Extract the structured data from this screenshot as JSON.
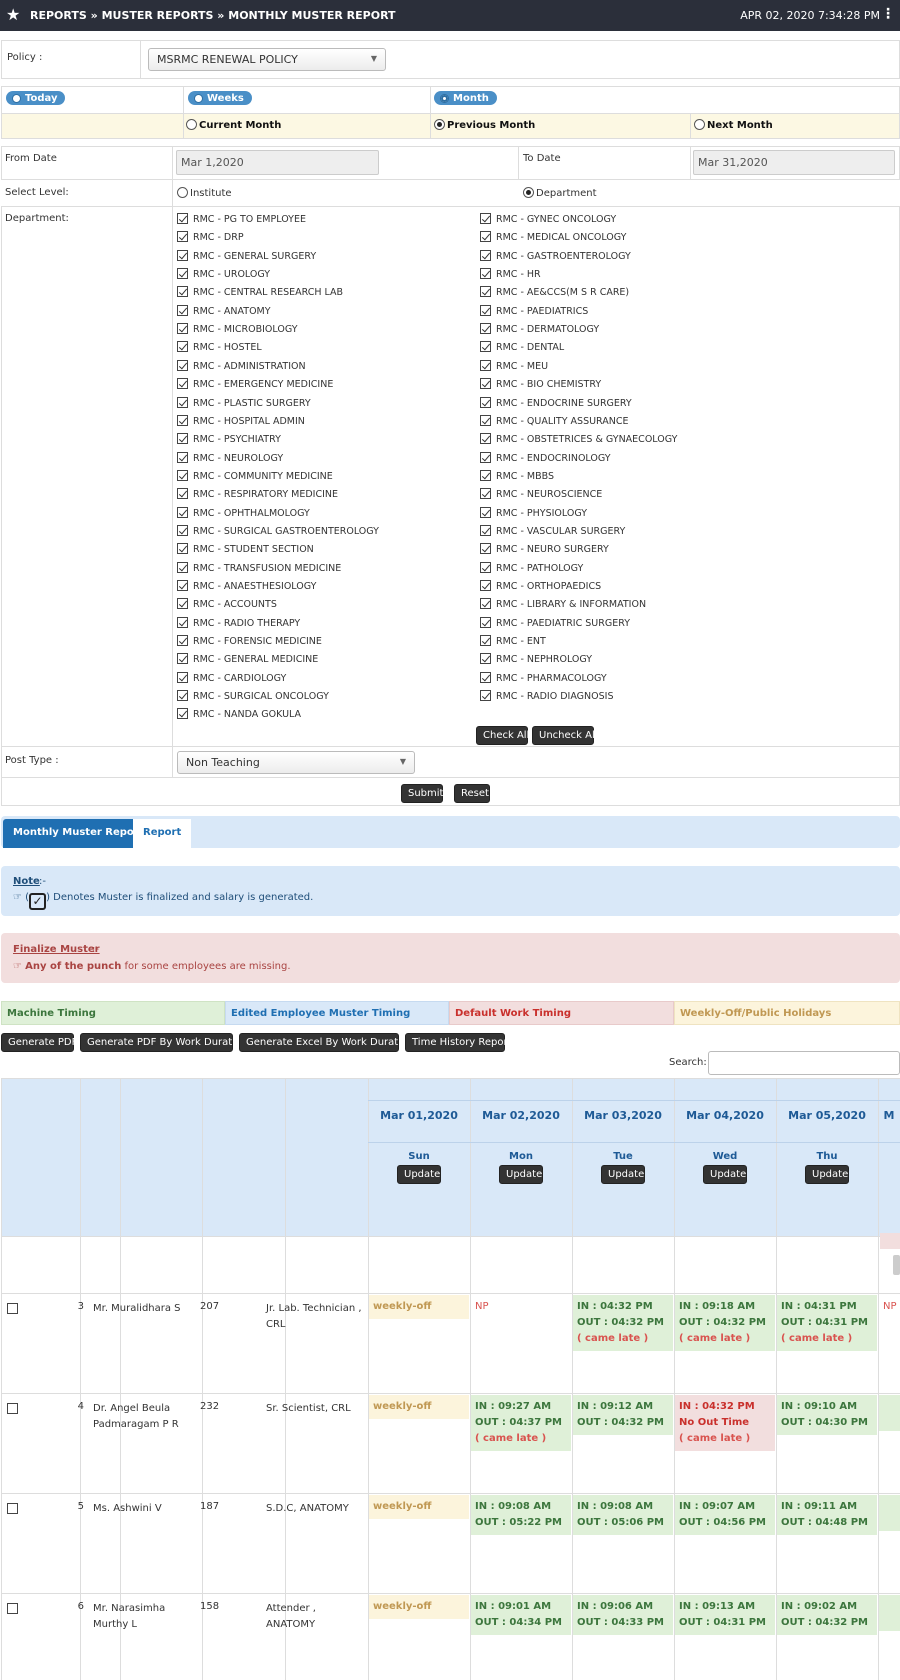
{
  "header": {
    "breadcrumb": "REPORTS » MUSTER REPORTS » MONTHLY MUSTER REPORT",
    "datetime": "APR 02, 2020   7:34:28 PM"
  },
  "form": {
    "policy_label": "Policy :",
    "policy_value": "MSRMC RENEWAL POLICY",
    "range_today": "Today",
    "range_weeks": "Weeks",
    "range_month": "Month",
    "current_month": "Current Month",
    "previous_month": "Previous Month",
    "next_month": "Next Month",
    "from_label": "From Date",
    "from_value": "Mar 1,2020",
    "to_label": "To Date",
    "to_value": "Mar 31,2020",
    "level_label": "Select Level:",
    "level_institute": "Institute",
    "level_department": "Department",
    "dept_label": "Department:",
    "departments_left": [
      "RMC - PG TO EMPLOYEE",
      "RMC - DRP",
      "RMC - GENERAL SURGERY",
      "RMC - UROLOGY",
      "RMC - CENTRAL RESEARCH LAB",
      "RMC - ANATOMY",
      "RMC - MICROBIOLOGY",
      "RMC - HOSTEL",
      "RMC - ADMINISTRATION",
      "RMC - EMERGENCY MEDICINE",
      "RMC - PLASTIC SURGERY",
      "RMC - HOSPITAL ADMIN",
      "RMC - PSYCHIATRY",
      "RMC - NEUROLOGY",
      "RMC - COMMUNITY MEDICINE",
      "RMC - RESPIRATORY MEDICINE",
      "RMC - OPHTHALMOLOGY",
      "RMC - SURGICAL GASTROENTEROLOGY",
      "RMC - STUDENT SECTION",
      "RMC - TRANSFUSION MEDICINE",
      "RMC - ANAESTHESIOLOGY",
      "RMC - ACCOUNTS",
      "RMC - RADIO THERAPY",
      "RMC - FORENSIC MEDICINE",
      "RMC - GENERAL MEDICINE",
      "RMC - CARDIOLOGY",
      "RMC - SURGICAL ONCOLOGY",
      "RMC - NANDA GOKULA"
    ],
    "departments_right": [
      "RMC - GYNEC ONCOLOGY",
      "RMC - MEDICAL ONCOLOGY",
      "RMC - GASTROENTEROLOGY",
      "RMC - HR",
      "RMC - AE&CCS(M S R CARE)",
      "RMC - PAEDIATRICS",
      "RMC - DERMATOLOGY",
      "RMC - DENTAL",
      "RMC - MEU",
      "RMC - BIO CHEMISTRY",
      "RMC - ENDOCRINE SURGERY",
      "RMC - QUALITY ASSURANCE",
      "RMC - OBSTETRICES & GYNAECOLOGY",
      "RMC - ENDOCRINOLOGY",
      "RMC - MBBS",
      "RMC - NEUROSCIENCE",
      "RMC - PHYSIOLOGY",
      "RMC - VASCULAR SURGERY",
      "RMC - NEURO SURGERY",
      "RMC - PATHOLOGY",
      "RMC - ORTHOPAEDICS",
      "RMC - LIBRARY & INFORMATION",
      "RMC - PAEDIATRIC SURGERY",
      "RMC - ENT",
      "RMC - NEPHROLOGY",
      "RMC - PHARMACOLOGY",
      "RMC - RADIO DIAGNOSIS"
    ],
    "check_all": "Check All",
    "uncheck_all": "Uncheck All",
    "post_type_label": "Post Type :",
    "post_type_value": "Non Teaching",
    "submit": "Submit",
    "reset": "Reset"
  },
  "tabs": {
    "monthly": "Monthly Muster Report",
    "report": "Report"
  },
  "note": {
    "title": "Note",
    "text": "Denotes Muster is finalized and salary is generated."
  },
  "finalize": {
    "title": "Finalize Muster",
    "bold": "Any of the punch",
    "text": " for some employees are missing."
  },
  "legend": {
    "machine": "Machine Timing",
    "edited": "Edited Employee Muster Timing",
    "default": "Default Work Timing",
    "weekly": "Weekly-Off/Public Holidays",
    "colors": {
      "machine": "#dff0d8",
      "edited": "#d9e8f8",
      "default": "#f2dede",
      "weekly": "#fcf4dc"
    }
  },
  "actions": {
    "pdf": "Generate PDF",
    "pdf_duration": "Generate PDF By Work Duration",
    "excel_duration": "Generate Excel By Work Duration",
    "time_history": "Time History Report",
    "search_label": "Search:"
  },
  "table": {
    "dates": [
      "Mar 01,2020",
      "Mar 02,2020",
      "Mar 03,2020",
      "Mar 04,2020",
      "Mar 05,2020"
    ],
    "days": [
      "Sun",
      "Mon",
      "Tue",
      "Wed",
      "Thu"
    ],
    "update_label": "Update",
    "rows": [
      {
        "no": "3",
        "name": "Mr. Muralidhara S",
        "code": "207",
        "designation": "Jr. Lab. Technician , CRL"
      },
      {
        "no": "4",
        "name": "Dr. Angel Beula Padmaragam P R",
        "code": "232",
        "designation": "Sr. Scientist, CRL"
      },
      {
        "no": "5",
        "name": "Ms. Ashwini V",
        "code": "187",
        "designation": "S.D.C, ANATOMY"
      },
      {
        "no": "6",
        "name": "Mr. Narasimha Murthy L",
        "code": "158",
        "designation": "Attender , ANATOMY"
      }
    ],
    "weekly_off": "weekly-off",
    "np": "NP",
    "in_label": "IN :",
    "out_label": "OUT :",
    "came_late": "( came late )",
    "no_out": "No Out Time",
    "r1": {
      "c2": "NP",
      "c3_in": "04:32 PM",
      "c3_out": "04:32 PM",
      "c4_in": "09:18 AM",
      "c4_out": "04:32 PM",
      "c5_in": "04:31 PM",
      "c5_out": "04:31 PM"
    },
    "r2": {
      "c2_in": "09:27 AM",
      "c2_out": "04:37 PM",
      "c3_in": "09:12 AM",
      "c3_out": "04:32 PM",
      "c4_in": "04:32 PM",
      "c5_in": "09:10 AM",
      "c5_out": "04:30 PM"
    },
    "r3": {
      "c2_in": "09:08 AM",
      "c2_out": "05:22 PM",
      "c3_in": "09:08 AM",
      "c3_out": "05:06 PM",
      "c4_in": "09:07 AM",
      "c4_out": "04:56 PM",
      "c5_in": "09:11 AM",
      "c5_out": "04:48 PM"
    },
    "r4": {
      "c2_in": "09:01 AM",
      "c2_out": "04:34 PM",
      "c3_in": "09:06 AM",
      "c3_out": "04:33 PM",
      "c4_in": "09:13 AM",
      "c4_out": "04:31 PM",
      "c5_in": "09:02 AM",
      "c5_out": "04:32 PM"
    }
  }
}
